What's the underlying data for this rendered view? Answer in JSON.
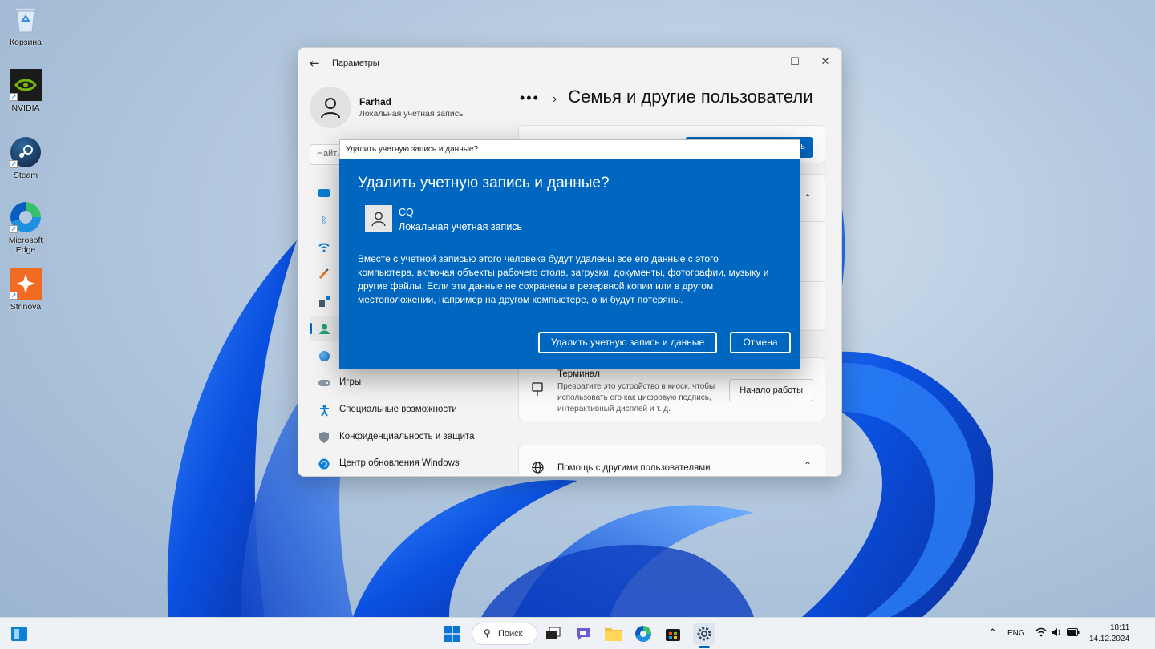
{
  "desktop": {
    "icons": [
      {
        "label": "Корзина",
        "icon": "recycle-bin-icon"
      },
      {
        "label": "NVIDIA",
        "icon": "nvidia-icon"
      },
      {
        "label": "Steam",
        "icon": "steam-icon"
      },
      {
        "label": "Microsoft Edge",
        "icon": "edge-icon"
      },
      {
        "label": "Strinova",
        "icon": "strinova-icon"
      }
    ]
  },
  "settings": {
    "title": "Параметры",
    "user_name": "Farhad",
    "user_type": "Локальная учетная запись",
    "search_placeholder": "Найти",
    "page_title": "Семья и другие пользователи",
    "breadcrumb_more": "•••",
    "nav": [
      {
        "label": "",
        "icon": "system-icon"
      },
      {
        "label": "",
        "icon": "bluetooth-icon"
      },
      {
        "label": "",
        "icon": "network-icon"
      },
      {
        "label": "",
        "icon": "personalization-icon"
      },
      {
        "label": "",
        "icon": "apps-icon"
      },
      {
        "label": "",
        "icon": "accounts-icon",
        "active": true
      },
      {
        "label": "",
        "icon": "time-language-icon"
      },
      {
        "label": "Игры",
        "icon": "gaming-icon"
      },
      {
        "label": "Специальные возможности",
        "icon": "accessibility-icon"
      },
      {
        "label": "Конфиденциальность и защита",
        "icon": "privacy-shield-icon"
      },
      {
        "label": "Центр обновления Windows",
        "icon": "windows-update-icon"
      }
    ],
    "kiosk": {
      "title": "Терминал",
      "description": "Превратите это устройство в киоск, чтобы использовать его как цифровую подпись, интерактивный дисплей и т. д.",
      "button": "Начало работы"
    },
    "help": {
      "title": "Помощь с другими пользователями"
    },
    "top_button": "ь"
  },
  "dialog": {
    "window_title": "Удалить учетную запись и данные?",
    "heading": "Удалить учетную запись и данные?",
    "user_name": "CQ",
    "user_type": "Локальная учетная запись",
    "message": "Вместе с учетной записью этого человека будут удалены все его данные с этого компьютера, включая объекты рабочего стола, загрузки, документы, фотографии, музыку и другие файлы. Если эти данные не сохранены в резервной копии или в другом местоположении, например на другом компьютере, они будут потеряны.",
    "confirm_button": "Удалить учетную запись и данные",
    "cancel_button": "Отмена",
    "accent_color": "#0067c0"
  },
  "taskbar": {
    "search_label": "Поиск",
    "language": "ENG",
    "time": "18:11",
    "date": "14.12.2024"
  }
}
